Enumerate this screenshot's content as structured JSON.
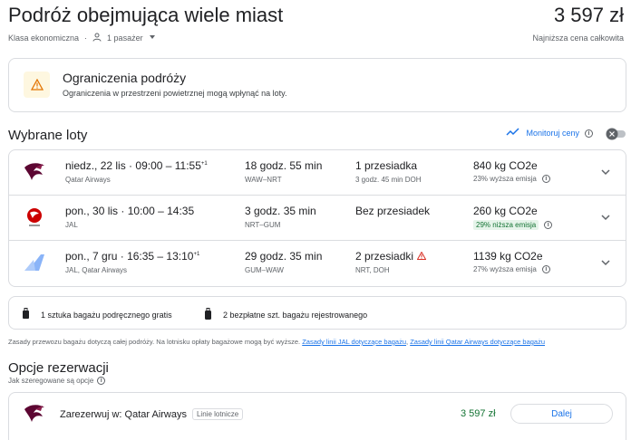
{
  "header": {
    "title": "Podróż obejmująca wiele miast",
    "price": "3 597 zł",
    "cabin_class": "Klasa ekonomiczna",
    "passengers": "1 pasażer",
    "price_note": "Najniższa cena całkowita"
  },
  "alert": {
    "title": "Ograniczenia podróży",
    "text": "Ograniczenia w przestrzeni powietrznej mogą wpłynąć na loty."
  },
  "selected": {
    "title": "Wybrane loty",
    "track_label": "Monitoruj ceny"
  },
  "flights": [
    {
      "logo": "qatar-airways-logo",
      "date": "niedz., 22 lis",
      "times": "09:00 – 11:55",
      "plus": "+1",
      "airline": "Qatar Airways",
      "duration": "18 godz. 55 min",
      "route": "WAW–NRT",
      "stops": "1 przesiadka",
      "stop_detail": "3 godz. 45 min DOH",
      "co2": "840 kg CO2e",
      "emission": "23% wyższa emisja"
    },
    {
      "logo": "jal-logo",
      "date": "pon., 30 lis",
      "times": "10:00 – 14:35",
      "plus": "",
      "airline": "JAL",
      "duration": "3 godz. 35 min",
      "route": "NRT–GUM",
      "stops": "Bez przesiadek",
      "stop_detail": "",
      "co2": "260 kg CO2e",
      "emission": "29% niższa emisja"
    },
    {
      "logo": "multi-airline-logo",
      "date": "pon., 7 gru",
      "times": "16:35 – 13:10",
      "plus": "+1",
      "airline": "JAL, Qatar Airways",
      "duration": "29 godz. 35 min",
      "route": "GUM–WAW",
      "stops": "2 przesiadki",
      "stop_detail": "NRT, DOH",
      "co2": "1139 kg CO2e",
      "emission": "27% wyższa emisja"
    }
  ],
  "baggage": {
    "carry_on": "1 sztuka bagażu podręcznego gratis",
    "checked": "2 bezpłatne szt. bagażu rejestrowanego"
  },
  "baggage_note": {
    "text": "Zasady przewozu bagażu dotyczą całej podróży. Na lotnisku opłaty bagażowe mogą być wyższe.",
    "link_jal": "Zasady linii JAL dotyczące bagażu",
    "link_qatar": "Zasady linii Qatar Airways dotyczące bagażu"
  },
  "booking": {
    "title": "Opcje rezerwacji",
    "sort_note": "Jak szeregowane są opcje",
    "option_name": "Zarezerwuj w: Qatar Airways",
    "chip": "Linie lotnicze",
    "price": "3 597 zł",
    "button": "Dalej"
  },
  "colors": {
    "accent": "#1a73e8",
    "green": "#137333",
    "border": "#dadce0",
    "warning": "#f29900",
    "error": "#d93025"
  }
}
